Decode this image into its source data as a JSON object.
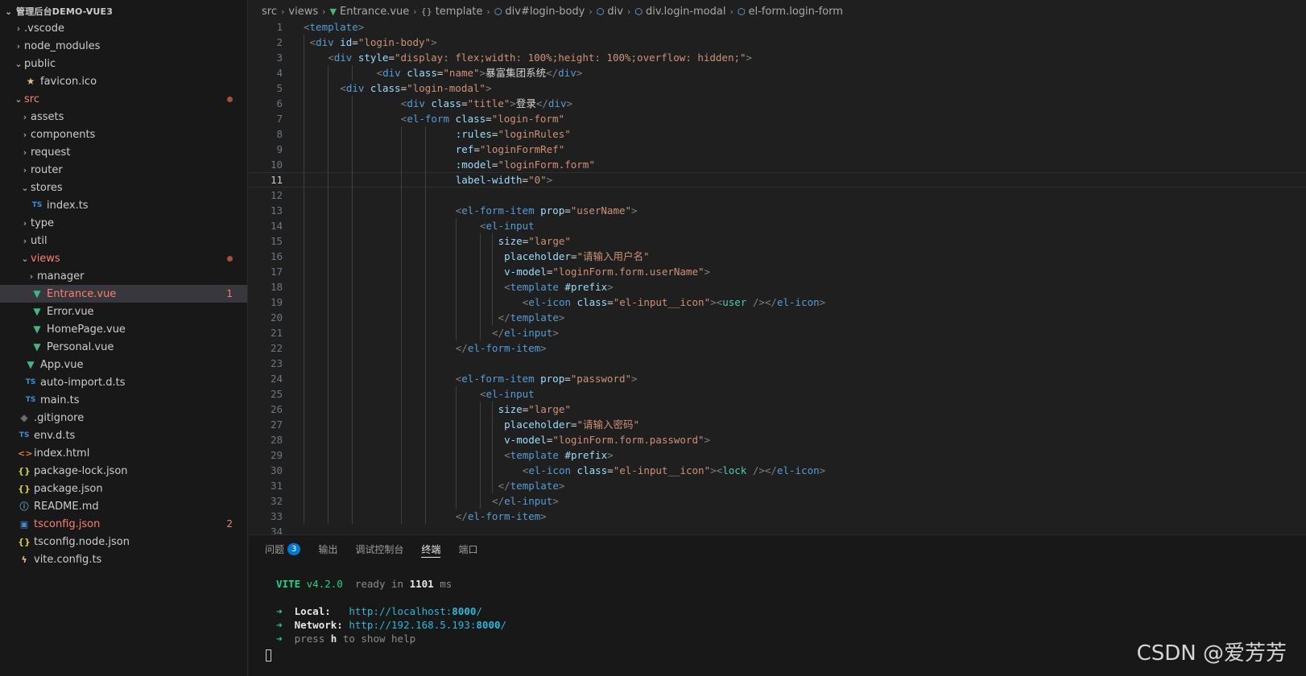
{
  "sidebar": {
    "title": "管理后台DEMO-VUE3",
    "items": [
      {
        "label": ".vscode",
        "depth": 1,
        "arrow": "›",
        "icon": ""
      },
      {
        "label": "node_modules",
        "depth": 1,
        "arrow": "›",
        "icon": ""
      },
      {
        "label": "public",
        "depth": 1,
        "arrow": "⌄",
        "icon": ""
      },
      {
        "label": "favicon.ico",
        "depth": 2,
        "arrow": "",
        "icon": "★",
        "iconClass": "star"
      },
      {
        "label": "src",
        "depth": 1,
        "arrow": "⌄",
        "icon": "",
        "modified": true,
        "dot": true
      },
      {
        "label": "assets",
        "depth": 2,
        "arrow": "›",
        "icon": ""
      },
      {
        "label": "components",
        "depth": 2,
        "arrow": "›",
        "icon": ""
      },
      {
        "label": "request",
        "depth": 2,
        "arrow": "›",
        "icon": ""
      },
      {
        "label": "router",
        "depth": 2,
        "arrow": "›",
        "icon": ""
      },
      {
        "label": "stores",
        "depth": 2,
        "arrow": "⌄",
        "icon": ""
      },
      {
        "label": "index.ts",
        "depth": 3,
        "arrow": "",
        "icon": "TS",
        "iconClass": "ts"
      },
      {
        "label": "type",
        "depth": 2,
        "arrow": "›",
        "icon": ""
      },
      {
        "label": "util",
        "depth": 2,
        "arrow": "›",
        "icon": ""
      },
      {
        "label": "views",
        "depth": 2,
        "arrow": "⌄",
        "icon": "",
        "modified": true,
        "dot": true
      },
      {
        "label": "manager",
        "depth": 3,
        "arrow": "›",
        "icon": ""
      },
      {
        "label": "Entrance.vue",
        "depth": 3,
        "arrow": "",
        "icon": "▼",
        "iconClass": "vue",
        "modified": true,
        "badge": "1",
        "selected": true
      },
      {
        "label": "Error.vue",
        "depth": 3,
        "arrow": "",
        "icon": "▼",
        "iconClass": "vue"
      },
      {
        "label": "HomePage.vue",
        "depth": 3,
        "arrow": "",
        "icon": "▼",
        "iconClass": "vue"
      },
      {
        "label": "Personal.vue",
        "depth": 3,
        "arrow": "",
        "icon": "▼",
        "iconClass": "vue"
      },
      {
        "label": "App.vue",
        "depth": 2,
        "arrow": "",
        "icon": "▼",
        "iconClass": "vue"
      },
      {
        "label": "auto-import.d.ts",
        "depth": 2,
        "arrow": "",
        "icon": "TS",
        "iconClass": "ts"
      },
      {
        "label": "main.ts",
        "depth": 2,
        "arrow": "",
        "icon": "TS",
        "iconClass": "ts"
      },
      {
        "label": ".gitignore",
        "depth": 1,
        "arrow": "",
        "icon": "◆",
        "iconClass": "git"
      },
      {
        "label": "env.d.ts",
        "depth": 1,
        "arrow": "",
        "icon": "TS",
        "iconClass": "ts"
      },
      {
        "label": "index.html",
        "depth": 1,
        "arrow": "",
        "icon": "<>",
        "iconClass": "html"
      },
      {
        "label": "package-lock.json",
        "depth": 1,
        "arrow": "",
        "icon": "{}",
        "iconClass": "json"
      },
      {
        "label": "package.json",
        "depth": 1,
        "arrow": "",
        "icon": "{}",
        "iconClass": "json"
      },
      {
        "label": "README.md",
        "depth": 1,
        "arrow": "",
        "icon": "ⓘ",
        "iconClass": "info"
      },
      {
        "label": "tsconfig.json",
        "depth": 1,
        "arrow": "",
        "icon": "▣",
        "iconClass": "tsconf",
        "modified": true,
        "badge": "2"
      },
      {
        "label": "tsconfig.node.json",
        "depth": 1,
        "arrow": "",
        "icon": "{}",
        "iconClass": "json"
      },
      {
        "label": "vite.config.ts",
        "depth": 1,
        "arrow": "",
        "icon": "ϟ",
        "iconClass": "vite"
      }
    ]
  },
  "breadcrumb": [
    {
      "label": "src",
      "icon": ""
    },
    {
      "label": "views",
      "icon": ""
    },
    {
      "label": "Entrance.vue",
      "icon": "▼",
      "iconClass": "vue"
    },
    {
      "label": "template",
      "icon": "{}",
      "iconClass": ""
    },
    {
      "label": "div#login-body",
      "icon": "⬡",
      "iconClass": "tag"
    },
    {
      "label": "div",
      "icon": "⬡",
      "iconClass": "tag"
    },
    {
      "label": "div.login-modal",
      "icon": "⬡",
      "iconClass": "tag"
    },
    {
      "label": "el-form.login-form",
      "icon": "⬡",
      "iconClass": "tag"
    }
  ],
  "editor": {
    "current_line": 11,
    "lines": [
      {
        "n": "1",
        "i": 0,
        "toks": [
          [
            "p",
            "<"
          ],
          [
            "t",
            "template"
          ],
          [
            "p",
            ">"
          ]
        ]
      },
      {
        "n": "2",
        "i": 1,
        "toks": [
          [
            "p",
            "<"
          ],
          [
            "t",
            "div"
          ],
          [
            "a",
            " id"
          ],
          [
            "x",
            "="
          ],
          [
            "s",
            "\"login-body\""
          ],
          [
            "p",
            ">"
          ]
        ]
      },
      {
        "n": "3",
        "i": 4,
        "toks": [
          [
            "p",
            "<"
          ],
          [
            "t",
            "div"
          ],
          [
            "a",
            " style"
          ],
          [
            "x",
            "="
          ],
          [
            "s",
            "\"display: "
          ],
          [
            "v",
            "flex"
          ],
          [
            "s",
            ";width: "
          ],
          [
            "v",
            "100%"
          ],
          [
            "s",
            ";height: "
          ],
          [
            "v",
            "100%"
          ],
          [
            "s",
            ";overflow: "
          ],
          [
            "v",
            "hidden"
          ],
          [
            "s",
            ";\""
          ],
          [
            "p",
            ">"
          ]
        ]
      },
      {
        "n": "4",
        "i": 12,
        "toks": [
          [
            "p",
            "<"
          ],
          [
            "t",
            "div"
          ],
          [
            "a",
            " class"
          ],
          [
            "x",
            "="
          ],
          [
            "s",
            "\"name\""
          ],
          [
            "p",
            ">"
          ],
          [
            "x",
            "暴富集团系统"
          ],
          [
            "p",
            "</"
          ],
          [
            "t",
            "div"
          ],
          [
            "p",
            ">"
          ]
        ]
      },
      {
        "n": "5",
        "i": 6,
        "toks": [
          [
            "p",
            "<"
          ],
          [
            "t",
            "div"
          ],
          [
            "a",
            " class"
          ],
          [
            "x",
            "="
          ],
          [
            "s",
            "\"login-modal\""
          ],
          [
            "p",
            ">"
          ]
        ]
      },
      {
        "n": "6",
        "i": 16,
        "toks": [
          [
            "p",
            "<"
          ],
          [
            "t",
            "div"
          ],
          [
            "a",
            " class"
          ],
          [
            "x",
            "="
          ],
          [
            "s",
            "\"title\""
          ],
          [
            "p",
            ">"
          ],
          [
            "x",
            "登录"
          ],
          [
            "p",
            "</"
          ],
          [
            "t",
            "div"
          ],
          [
            "p",
            ">"
          ]
        ]
      },
      {
        "n": "7",
        "i": 16,
        "toks": [
          [
            "p",
            "<"
          ],
          [
            "t",
            "el-form"
          ],
          [
            "a",
            " class"
          ],
          [
            "x",
            "="
          ],
          [
            "s",
            "\"login-form\""
          ]
        ]
      },
      {
        "n": "8",
        "i": 25,
        "toks": [
          [
            "a",
            ":rules"
          ],
          [
            "x",
            "="
          ],
          [
            "s",
            "\"loginRules\""
          ]
        ]
      },
      {
        "n": "9",
        "i": 25,
        "toks": [
          [
            "a",
            "ref"
          ],
          [
            "x",
            "="
          ],
          [
            "s",
            "\"loginFormRef\""
          ]
        ]
      },
      {
        "n": "10",
        "i": 25,
        "toks": [
          [
            "a",
            ":model"
          ],
          [
            "x",
            "="
          ],
          [
            "s",
            "\"loginForm.form\""
          ]
        ]
      },
      {
        "n": "11",
        "i": 25,
        "toks": [
          [
            "a",
            "label-width"
          ],
          [
            "x",
            "="
          ],
          [
            "s",
            "\"0\""
          ],
          [
            "p",
            ">"
          ]
        ]
      },
      {
        "n": "12",
        "i": 0,
        "toks": []
      },
      {
        "n": "13",
        "i": 25,
        "toks": [
          [
            "p",
            "<"
          ],
          [
            "t",
            "el-form-item"
          ],
          [
            "a",
            " prop"
          ],
          [
            "x",
            "="
          ],
          [
            "s",
            "\"userName\""
          ],
          [
            "p",
            ">"
          ]
        ]
      },
      {
        "n": "14",
        "i": 29,
        "toks": [
          [
            "p",
            "<"
          ],
          [
            "t",
            "el-input"
          ]
        ]
      },
      {
        "n": "15",
        "i": 32,
        "toks": [
          [
            "a",
            "size"
          ],
          [
            "x",
            "="
          ],
          [
            "s",
            "\"large\""
          ]
        ]
      },
      {
        "n": "16",
        "i": 33,
        "toks": [
          [
            "a",
            "placeholder"
          ],
          [
            "x",
            "="
          ],
          [
            "s",
            "\"请输入用户名\""
          ]
        ]
      },
      {
        "n": "17",
        "i": 33,
        "toks": [
          [
            "a",
            "v-model"
          ],
          [
            "x",
            "="
          ],
          [
            "s",
            "\"loginForm.form.userName\""
          ],
          [
            "p",
            ">"
          ]
        ]
      },
      {
        "n": "18",
        "i": 33,
        "toks": [
          [
            "p",
            "<"
          ],
          [
            "t",
            "template"
          ],
          [
            "a",
            " #prefix"
          ],
          [
            "p",
            ">"
          ]
        ]
      },
      {
        "n": "19",
        "i": 36,
        "toks": [
          [
            "p",
            "<"
          ],
          [
            "t",
            "el-icon"
          ],
          [
            "a",
            " class"
          ],
          [
            "x",
            "="
          ],
          [
            "s",
            "\"el-input__icon\""
          ],
          [
            "p",
            ">"
          ],
          [
            "p",
            "<"
          ],
          [
            "c",
            "user"
          ],
          [
            "p",
            " />"
          ],
          [
            "p",
            "</"
          ],
          [
            "t",
            "el-icon"
          ],
          [
            "p",
            ">"
          ]
        ]
      },
      {
        "n": "20",
        "i": 32,
        "toks": [
          [
            "p",
            "</"
          ],
          [
            "t",
            "template"
          ],
          [
            "p",
            ">"
          ]
        ]
      },
      {
        "n": "21",
        "i": 31,
        "toks": [
          [
            "p",
            "</"
          ],
          [
            "t",
            "el-input"
          ],
          [
            "p",
            ">"
          ]
        ]
      },
      {
        "n": "22",
        "i": 25,
        "toks": [
          [
            "p",
            "</"
          ],
          [
            "t",
            "el-form-item"
          ],
          [
            "p",
            ">"
          ]
        ]
      },
      {
        "n": "23",
        "i": 0,
        "toks": []
      },
      {
        "n": "24",
        "i": 25,
        "toks": [
          [
            "p",
            "<"
          ],
          [
            "t",
            "el-form-item"
          ],
          [
            "a",
            " prop"
          ],
          [
            "x",
            "="
          ],
          [
            "s",
            "\"password\""
          ],
          [
            "p",
            ">"
          ]
        ]
      },
      {
        "n": "25",
        "i": 29,
        "toks": [
          [
            "p",
            "<"
          ],
          [
            "t",
            "el-input"
          ]
        ]
      },
      {
        "n": "26",
        "i": 32,
        "toks": [
          [
            "a",
            "size"
          ],
          [
            "x",
            "="
          ],
          [
            "s",
            "\"large\""
          ]
        ]
      },
      {
        "n": "27",
        "i": 33,
        "toks": [
          [
            "a",
            "placeholder"
          ],
          [
            "x",
            "="
          ],
          [
            "s",
            "\"请输入密码\""
          ]
        ]
      },
      {
        "n": "28",
        "i": 33,
        "toks": [
          [
            "a",
            "v-model"
          ],
          [
            "x",
            "="
          ],
          [
            "s",
            "\"loginForm.form.password\""
          ],
          [
            "p",
            ">"
          ]
        ]
      },
      {
        "n": "29",
        "i": 33,
        "toks": [
          [
            "p",
            "<"
          ],
          [
            "t",
            "template"
          ],
          [
            "a",
            " #prefix"
          ],
          [
            "p",
            ">"
          ]
        ]
      },
      {
        "n": "30",
        "i": 36,
        "toks": [
          [
            "p",
            "<"
          ],
          [
            "t",
            "el-icon"
          ],
          [
            "a",
            " class"
          ],
          [
            "x",
            "="
          ],
          [
            "s",
            "\"el-input__icon\""
          ],
          [
            "p",
            ">"
          ],
          [
            "p",
            "<"
          ],
          [
            "c",
            "lock"
          ],
          [
            "p",
            " />"
          ],
          [
            "p",
            "</"
          ],
          [
            "t",
            "el-icon"
          ],
          [
            "p",
            ">"
          ]
        ]
      },
      {
        "n": "31",
        "i": 32,
        "toks": [
          [
            "p",
            "</"
          ],
          [
            "t",
            "template"
          ],
          [
            "p",
            ">"
          ]
        ]
      },
      {
        "n": "32",
        "i": 31,
        "toks": [
          [
            "p",
            "</"
          ],
          [
            "t",
            "el-input"
          ],
          [
            "p",
            ">"
          ]
        ]
      },
      {
        "n": "33",
        "i": 25,
        "toks": [
          [
            "p",
            "</"
          ],
          [
            "t",
            "el-form-item"
          ],
          [
            "p",
            ">"
          ]
        ]
      },
      {
        "n": "34",
        "i": 0,
        "toks": []
      }
    ]
  },
  "panel": {
    "tabs": [
      {
        "label": "问题",
        "count": "3"
      },
      {
        "label": "输出"
      },
      {
        "label": "调试控制台"
      },
      {
        "label": "终端",
        "active": true
      },
      {
        "label": "端口"
      }
    ],
    "terminal": {
      "vite_name": "VITE",
      "vite_version": "v4.2.0",
      "ready_text": "ready in",
      "ready_ms": "1101",
      "ready_unit": "ms",
      "arrow": "➜",
      "local_label": "Local:",
      "local_url_prefix": "http://localhost:",
      "local_port": "8000",
      "local_url_suffix": "/",
      "network_label": "Network:",
      "network_url_prefix": "http://192.168.5.193:",
      "network_port": "8000",
      "network_url_suffix": "/",
      "help_press": "press",
      "help_key": "h",
      "help_rest": "to show help"
    }
  },
  "watermark": "CSDN @爱芳芳"
}
